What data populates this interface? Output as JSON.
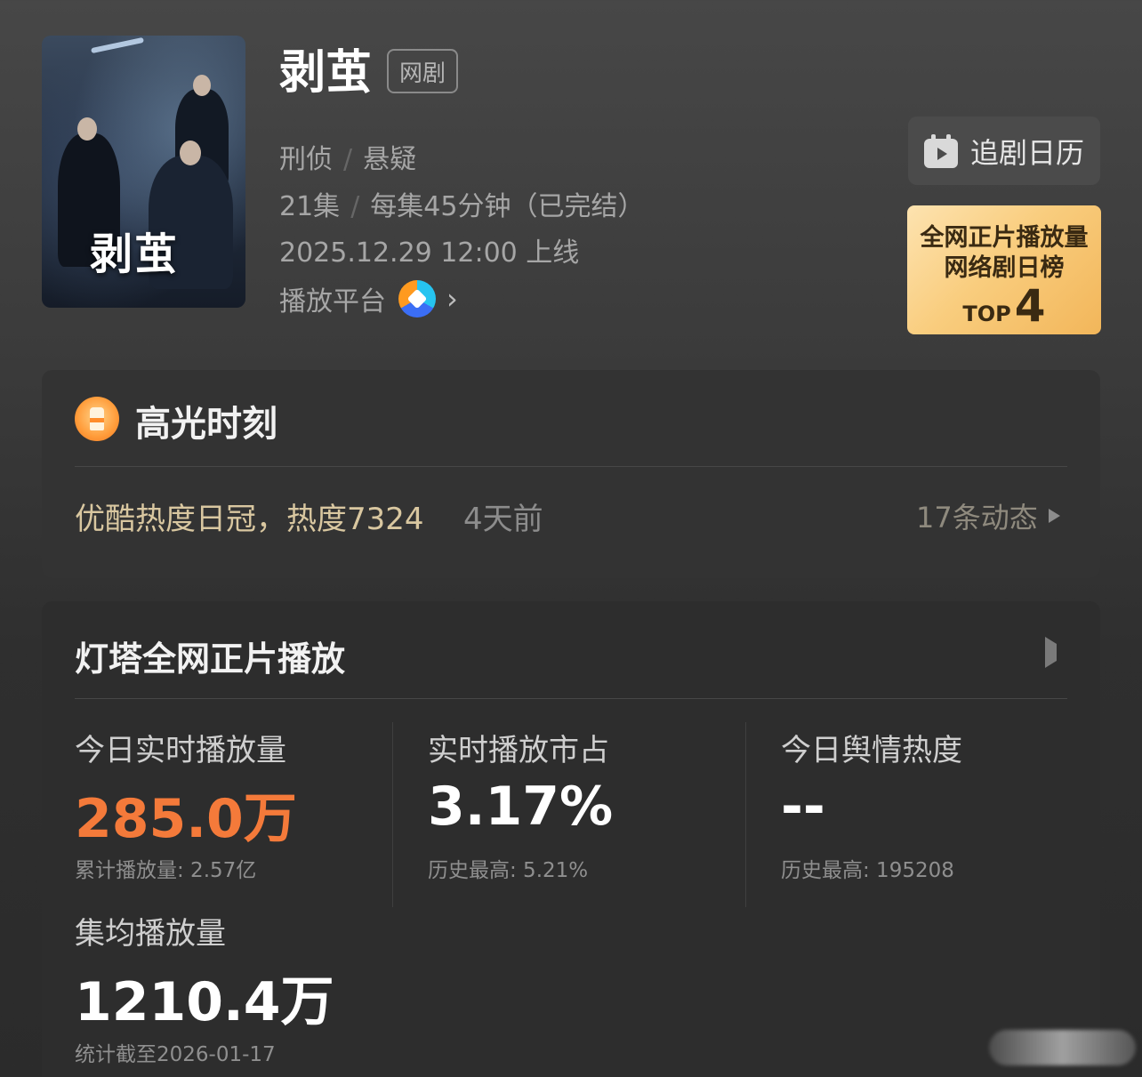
{
  "drama": {
    "poster_title": "剥茧",
    "title": "剥茧",
    "tag": "网剧",
    "genre1": "刑侦",
    "genre2": "悬疑",
    "separator": "/",
    "episodes": "21集",
    "duration": "每集45分钟（已完结）",
    "release": "2025.12.29 12:00 上线",
    "platform_label": "播放平台",
    "platform_chevron": "›"
  },
  "calendar_button": {
    "label": "追剧日历"
  },
  "rank_badge": {
    "line1": "全网正片播放量",
    "line2": "网络剧日榜",
    "top_label": "TOP",
    "rank": "4"
  },
  "highlight": {
    "title": "高光时刻",
    "text": "优酷热度日冠，热度7324",
    "time": "4天前",
    "link": "17条动态"
  },
  "stats": {
    "title": "灯塔全网正片播放",
    "items": [
      {
        "label": "今日实时播放量",
        "value": "285.0万",
        "sub": "累计播放量: 2.57亿"
      },
      {
        "label": "实时播放市占",
        "value": "3.17%",
        "sub": "历史最高: 5.21%"
      },
      {
        "label": "今日舆情热度",
        "value": "--",
        "sub": "历史最高: 195208"
      },
      {
        "label": "集均播放量",
        "value": "1210.4万",
        "sub": "统计截至2026-01-17"
      }
    ]
  },
  "colors": {
    "accent_hot": "#f47a3a",
    "gold_text": "#d9c7a0",
    "badge_gold": "#f9cd7e"
  }
}
